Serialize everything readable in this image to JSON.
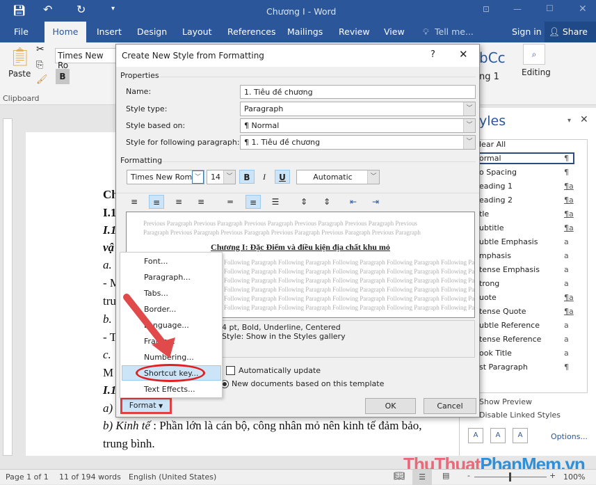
{
  "app": {
    "title": "Chương I - Word",
    "tabs": [
      "File",
      "Home",
      "Insert",
      "Design",
      "Layout",
      "References",
      "Mailings",
      "Review",
      "View"
    ],
    "tell_me": "Tell me...",
    "sign_in": "Sign in",
    "share": "Share"
  },
  "ribbon": {
    "font_name": "Times New Ro",
    "paste": "Paste",
    "clipboard": "Clipboard",
    "editing": "Editing",
    "style_preview": "bCc",
    "style_preview_label": "ng 1"
  },
  "document": {
    "lines": [
      "Ch",
      "I.1",
      "I.1",
      "vậ",
      "a.",
      "- M",
      "tru",
      "b.",
      "- T",
      "c.",
      " M",
      "I.1",
      "a)"
    ],
    "line_kinh_te_italic": "b) Kinh tế",
    "line_kinh_te_rest": " : Phần lớn là cán bộ, công nhân mỏ nên kinh tế đảm bảo,",
    "line_last": "trung bình."
  },
  "status": {
    "page": "Page 1 of 1",
    "words": "11 of 194 words",
    "language": "English (United States)",
    "zoom": "100%"
  },
  "styles_pane": {
    "title": "yles",
    "items": [
      {
        "label": "lear All",
        "glyph": ""
      },
      {
        "label": "ormal",
        "glyph": "¶"
      },
      {
        "label": "o Spacing",
        "glyph": "¶"
      },
      {
        "label": "eading 1",
        "glyph": "¶a"
      },
      {
        "label": "eading 2",
        "glyph": "¶a"
      },
      {
        "label": "tle",
        "glyph": "¶a"
      },
      {
        "label": "ubtitle",
        "glyph": "¶a"
      },
      {
        "label": "ubtle Emphasis",
        "glyph": "a"
      },
      {
        "label": "mphasis",
        "glyph": "a"
      },
      {
        "label": "tense Emphasis",
        "glyph": "a"
      },
      {
        "label": "trong",
        "glyph": "a"
      },
      {
        "label": "uote",
        "glyph": "¶a"
      },
      {
        "label": "tense Quote",
        "glyph": "¶a"
      },
      {
        "label": "ubtle Reference",
        "glyph": "a"
      },
      {
        "label": "tense Reference",
        "glyph": "a"
      },
      {
        "label": "ook Title",
        "glyph": "a"
      },
      {
        "label": "st Paragraph",
        "glyph": "¶"
      }
    ],
    "show_preview": "Show Preview",
    "disable_linked": "Disable Linked Styles",
    "options": "Options..."
  },
  "dialog": {
    "title": "Create New Style from Formatting",
    "help": "?",
    "properties": "Properties",
    "name_label": "Name:",
    "name_value": "1. Tiêu đề chương",
    "type_label": "Style type:",
    "type_value": "Paragraph",
    "based_label": "Style based on:",
    "based_value": "¶  Normal",
    "following_label": "Style for following paragraph:",
    "following_value": "¶  1. Tiêu đề chương",
    "formatting": "Formatting",
    "font": "Times New Roman",
    "size": "14",
    "bold": "B",
    "italic": "I",
    "underline": "U",
    "color": "Automatic",
    "preview_prev": "Previous Paragraph Previous Paragraph Previous Paragraph Previous Paragraph Previous Paragraph Previous Paragraph Previous Paragraph Previous Paragraph Previous Paragraph Previous Paragraph Previous Paragraph",
    "preview_heading": "Chương I: Đặc Điểm và điều kiện địa chất khu mỏ",
    "preview_following": "Following Paragraph Following Paragraph Following Paragraph Following Paragraph Following Paragraph",
    "description_1": "4 pt, Bold, Underline, Centered",
    "description_2": "Style: Show in the Styles gallery",
    "auto_update": "Automatically update",
    "new_docs": "New documents based on this template",
    "format_button": "Format",
    "ok": "OK",
    "cancel": "Cancel"
  },
  "format_menu": {
    "items": [
      "Font...",
      "Paragraph...",
      "Tabs...",
      "Border...",
      "Language...",
      "Frame...",
      "Numbering...",
      "Shortcut key...",
      "Text Effects..."
    ],
    "highlighted": "Shortcut key..."
  },
  "watermark": "ThuThuatPhanMem.vn",
  "colors": {
    "word_blue": "#2b579a",
    "annotation_red": "#e04040",
    "highlight": "#cce4f7"
  }
}
